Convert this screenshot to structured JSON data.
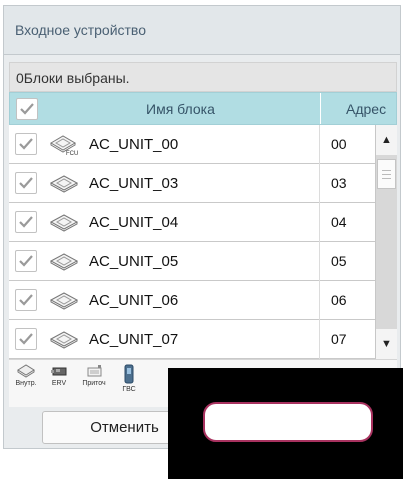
{
  "dialog": {
    "title": "Входное устройство",
    "selection_info": "0Блоки выбраны.",
    "columns": {
      "name": "Имя блока",
      "address": "Адрес"
    },
    "units": [
      {
        "name": "AC_UNIT_00",
        "address": "00",
        "icon": "fcu-cassette-icon",
        "checked": true
      },
      {
        "name": "AC_UNIT_03",
        "address": "03",
        "icon": "cassette-unit-icon",
        "checked": true
      },
      {
        "name": "AC_UNIT_04",
        "address": "04",
        "icon": "cassette-unit-icon",
        "checked": true
      },
      {
        "name": "AC_UNIT_05",
        "address": "05",
        "icon": "cassette-unit-icon",
        "checked": true
      },
      {
        "name": "AC_UNIT_06",
        "address": "06",
        "icon": "cassette-unit-icon",
        "checked": true
      },
      {
        "name": "AC_UNIT_07",
        "address": "07",
        "icon": "cassette-unit-icon",
        "checked": true
      }
    ],
    "scrollbar": {
      "up": "▲",
      "down": "▼"
    },
    "filters": [
      {
        "label": "Внутр.",
        "icon": "indoor-unit-icon"
      },
      {
        "label": "ERV",
        "icon": "erv-icon"
      },
      {
        "label": "Приточ",
        "icon": "supply-air-icon"
      },
      {
        "label": "ГВС",
        "icon": "hot-water-icon"
      }
    ],
    "buttons": {
      "cancel": "Отменить"
    }
  },
  "colors": {
    "header_row": "#b1dde3",
    "title_bar": "#e2e7ea",
    "highlight_outline": "#a8325f",
    "check_mark": "#9a9a9a"
  }
}
